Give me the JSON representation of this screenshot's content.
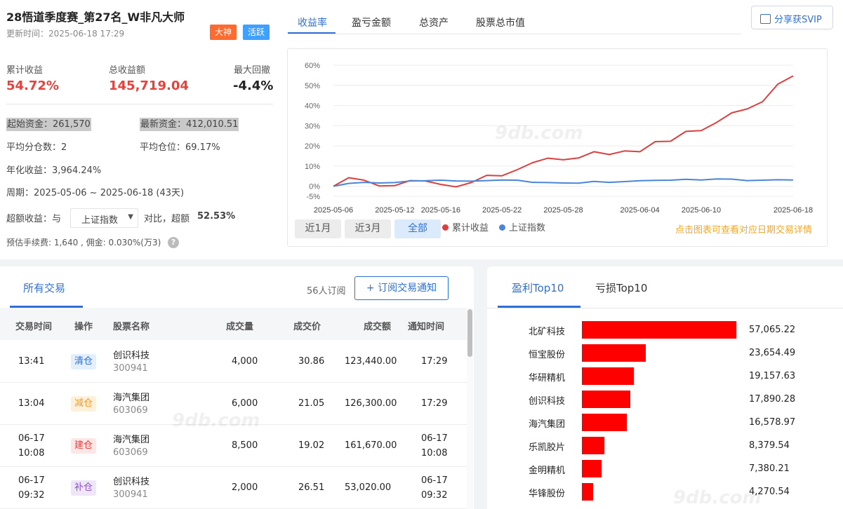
{
  "header": {
    "title": "28悟道季度赛_第27名_W非凡大师",
    "update_time": "更新时间：2025-06-18 17:29",
    "badges": [
      "大神",
      "活跃"
    ]
  },
  "stats": {
    "cumulative_label": "累计收益",
    "cumulative_value": "54.72%",
    "total_label": "总收益额",
    "total_value": "145,719.04",
    "drawdown_label": "最大回撤",
    "drawdown_value": "-4.4%"
  },
  "info": {
    "initial_capital": "起始资金：261,570",
    "latest_capital": "最新资金：412,010.51",
    "avg_splits": "平均分仓数：2",
    "avg_position": "平均仓位：69.17%",
    "annual_return": "年化收益：3,964.24%",
    "period": "周期：2025-05-06 ~ 2025-06-18 (43天)",
    "excess_prefix": "超额收益：与",
    "excess_index": "上证指数",
    "excess_mid": "对比，超额",
    "excess_value": "52.53%",
    "fees": "预估手续费: 1,640 , 佣金: 0.030%(万3)"
  },
  "chart_tabs": [
    "收益率",
    "盈亏金额",
    "总资产",
    "股票总市值"
  ],
  "share_button": "分享获SVIP",
  "range_buttons": [
    "近1月",
    "近3月",
    "全部"
  ],
  "chart_hint": "点击图表可查看对应日期交易详情",
  "colors": {
    "strategy": "#d94040",
    "index": "#4a86d8",
    "accent": "#2f6fd8"
  },
  "watermark": "9db.com",
  "chart_data": {
    "type": "line",
    "y_ticks": [
      "60%",
      "50%",
      "40%",
      "30%",
      "20%",
      "10%",
      "0%",
      "-5%"
    ],
    "ylim": [
      -5,
      60
    ],
    "x_ticks": [
      "2025-05-06",
      "2025-05-12",
      "2025-05-16",
      "2025-05-22",
      "2025-05-28",
      "2025-06-04",
      "2025-06-10",
      "2025-06-18"
    ],
    "series": [
      {
        "name": "累计收益",
        "values": [
          0,
          4.2,
          3.0,
          0.1,
          0.3,
          2.8,
          2.6,
          0.9,
          -0.3,
          1.8,
          5.4,
          5.2,
          8.2,
          11.7,
          13.9,
          13.1,
          14.0,
          17.1,
          15.7,
          17.5,
          17.1,
          22.1,
          22.3,
          27.2,
          27.6,
          31.6,
          36.4,
          38.3,
          41.9,
          50.6,
          54.7
        ]
      },
      {
        "name": "上证指数",
        "values": [
          0,
          1.4,
          1.9,
          1.6,
          1.8,
          2.6,
          2.7,
          3.0,
          2.6,
          2.5,
          2.8,
          3.1,
          3.0,
          1.9,
          1.8,
          1.6,
          1.5,
          2.4,
          1.9,
          2.3,
          2.7,
          2.9,
          3.0,
          3.4,
          3.1,
          3.6,
          3.5,
          2.8,
          3.0,
          3.2,
          3.1
        ]
      }
    ]
  },
  "trades": {
    "tab_label": "所有交易",
    "subscriber_count": "56人订阅",
    "subscribe_button": "+ 订阅交易通知",
    "columns": [
      "交易时间",
      "操作",
      "股票名称",
      "成交量",
      "成交价",
      "成交额",
      "通知时间"
    ],
    "rows": [
      {
        "time": "13:41",
        "time2": "",
        "action": "清仓",
        "action_type": "clear",
        "name": "创识科技",
        "code": "300941",
        "volume": "4,000",
        "price": "30.86",
        "amount": "123,440.00",
        "notify": "17:29",
        "notify2": ""
      },
      {
        "time": "13:04",
        "time2": "",
        "action": "减仓",
        "action_type": "reduce",
        "name": "海汽集团",
        "code": "603069",
        "volume": "6,000",
        "price": "21.05",
        "amount": "126,300.00",
        "notify": "17:29",
        "notify2": ""
      },
      {
        "time": "06-17",
        "time2": "10:08",
        "action": "建仓",
        "action_type": "build",
        "name": "海汽集团",
        "code": "603069",
        "volume": "8,500",
        "price": "19.02",
        "amount": "161,670.00",
        "notify": "06-17",
        "notify2": "10:08"
      },
      {
        "time": "06-17",
        "time2": "09:32",
        "action": "补仓",
        "action_type": "add",
        "name": "创识科技",
        "code": "300941",
        "volume": "2,000",
        "price": "26.51",
        "amount": "53,020.00",
        "notify": "06-17",
        "notify2": "09:32"
      }
    ]
  },
  "top10": {
    "tabs": [
      "盈利Top10",
      "亏损Top10"
    ],
    "items": [
      {
        "name": "北矿科技",
        "value": "57,065.22",
        "amount": 57065.22
      },
      {
        "name": "恒宝股份",
        "value": "23,654.49",
        "amount": 23654.49
      },
      {
        "name": "华研精机",
        "value": "19,157.63",
        "amount": 19157.63
      },
      {
        "name": "创识科技",
        "value": "17,890.28",
        "amount": 17890.28
      },
      {
        "name": "海汽集团",
        "value": "16,578.97",
        "amount": 16578.97
      },
      {
        "name": "乐凯胶片",
        "value": "8,379.54",
        "amount": 8379.54
      },
      {
        "name": "金明精机",
        "value": "7,380.21",
        "amount": 7380.21
      },
      {
        "name": "华锋股份",
        "value": "4,270.54",
        "amount": 4270.54
      }
    ]
  }
}
